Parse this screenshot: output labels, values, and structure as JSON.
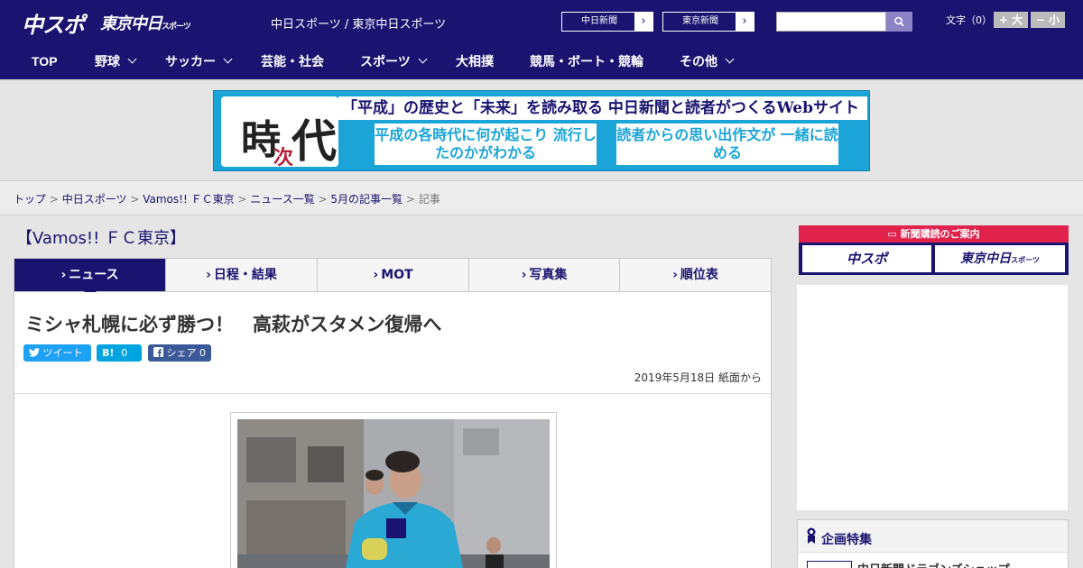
{
  "header": {
    "logo_main": "中スポ",
    "logo_tokyo": "東京中日",
    "logo_tokyo_small": "スポーツ",
    "site_name": "中日スポーツ / 東京中日スポーツ",
    "links": [
      {
        "label": "中日新聞"
      },
      {
        "label": "東京新聞"
      }
    ],
    "search_placeholder": "",
    "font_size_label": "文字（0）",
    "font_up": "+ 大",
    "font_down": "− 小"
  },
  "nav": {
    "items": [
      {
        "label": "TOP",
        "dropdown": false
      },
      {
        "label": "野球",
        "dropdown": true
      },
      {
        "label": "サッカー",
        "dropdown": true
      },
      {
        "label": "芸能・社会",
        "dropdown": false
      },
      {
        "label": "スポーツ",
        "dropdown": true
      },
      {
        "label": "大相撲",
        "dropdown": false
      },
      {
        "label": "競馬・ボート・競輪",
        "dropdown": false
      },
      {
        "label": "その他",
        "dropdown": true
      }
    ]
  },
  "banner": {
    "kanji_a": "時",
    "kanji_b": "次",
    "kanji_c": "代",
    "headline": "「平成」の歴史と「未来」を読み取る 中日新聞と読者がつくるWebサイト",
    "sub_left": "平成の各時代に何が起こり 流行したのかがわかる",
    "sub_right": "読者からの思い出作文が 一緒に読める"
  },
  "breadcrumb": {
    "items": [
      "トップ",
      "中日スポーツ",
      "Vamos!! ＦＣ東京",
      "ニュース一覧",
      "5月の記事一覧"
    ],
    "current": "記事",
    "separator": ">"
  },
  "section": {
    "title": "【Vamos!! ＦＣ東京】"
  },
  "tabs": [
    {
      "label": "ニュース",
      "active": true
    },
    {
      "label": "日程・結果",
      "active": false
    },
    {
      "label": "MOT",
      "active": false
    },
    {
      "label": "写真集",
      "active": false
    },
    {
      "label": "順位表",
      "active": false
    }
  ],
  "article": {
    "headline": "ミシャ札幌に必ず勝つ！　高萩がスタメン復帰へ",
    "tweet_label": "ツイート",
    "hatena_label": "B!",
    "hatena_count": "0",
    "share_label": "シェア",
    "share_count": "0",
    "date": "2019年5月18日 紙面から"
  },
  "sidebar": {
    "promo_title": "新聞購読のご案内",
    "promo_left": "中スポ",
    "promo_right": "東京中日",
    "promo_right_small": "スポーツ",
    "feature_title": "企画特集",
    "feature_item": "中日新聞ドラゴンズショップ"
  },
  "colors": {
    "brand": "#1a1470",
    "accent_red": "#e0224d",
    "banner_blue": "#1aa4d8",
    "twitter": "#1da1f2",
    "facebook": "#3b5998"
  }
}
